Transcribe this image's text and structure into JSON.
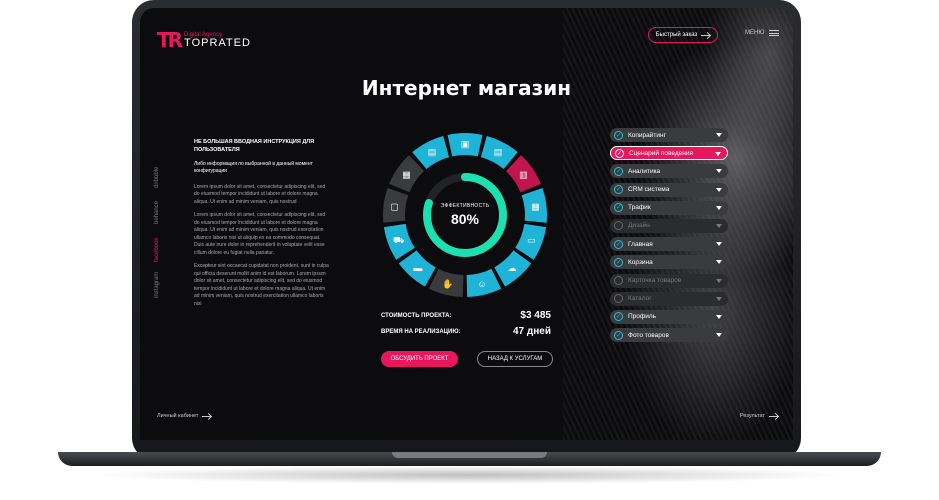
{
  "brand": {
    "mark": "TR",
    "sub": "Digital Agency",
    "name": "TOPRATED"
  },
  "header": {
    "quick_order": "Быстрый заказ",
    "menu": "МЕНЮ"
  },
  "title": "Интернет магазин",
  "social": [
    "dribbble",
    "behance",
    "facebook",
    "instagram"
  ],
  "intro": {
    "heading": "НЕ БОЛЬШАЯ ВВОДНАЯ ИНСТРУКЦИЯ ДЛЯ ПОЛЬЗОВАТЕЛЯ",
    "sub": "Либо информация по выбранной в данный момент конфигурации",
    "p1": "Lorem ipsum dolor sit amet, consectetur adipiscing elit, sed do eiusmod tempor incididunt ut labore et dolore magna aliqua. Ut enim ad minim veniam, quis nostrud",
    "p2": "Lorem ipsum dolor sit amet, consectetur adipiscing elit, sed do eiusmod tempor incididunt ut labore et dolore magna aliqua. Ut enim ad minim veniam, quis nostrud exercitation ullamco laboris nisi ut aliquip ex ea commodo consequat. Duis aute irure dolor in reprehenderit in voluptate velit esse cillum dolore eu fugiat nulla pariatur.",
    "p3": "Excepteur sint occaecat cupidatat non proident, sunt in culpa qui officia deserunt mollit anim id est laborum. Lorem ipsum dolor sit amet, consectetur adipiscing elit, sed do eiusmod tempor incididunt ut labore et dolore magna aliqua. Ut enim ad minim veniam, quis nostrud exercitation ullamco laboris nisi"
  },
  "efficiency": {
    "label": "ЭФФЕКТИВНОСТЬ",
    "value": "80%",
    "fraction": 0.8
  },
  "cost": {
    "label": "СТОИМОСТЬ ПРОЕКТА:",
    "value": "$3 485"
  },
  "time": {
    "label": "ВРЕМЯ НА РЕАЛИЗАЦИЮ:",
    "value": "47 дней"
  },
  "buttons": {
    "discuss": "ОБСУДИТЬ ПРОЕКТ",
    "back": "НАЗАД К УСЛУГАМ"
  },
  "services": [
    {
      "label": "Копирайтинг",
      "state": "on"
    },
    {
      "label": "Сценарий поведения",
      "state": "active"
    },
    {
      "label": "Аналитика",
      "state": "on"
    },
    {
      "label": "CRM система",
      "state": "on"
    },
    {
      "label": "Трафик",
      "state": "on"
    },
    {
      "label": "Дизайн",
      "state": "off"
    },
    {
      "label": "Главная",
      "state": "on"
    },
    {
      "label": "Корзина",
      "state": "on"
    },
    {
      "label": "Карточка товаров",
      "state": "off"
    },
    {
      "label": "Каталог",
      "state": "off"
    },
    {
      "label": "Профиль",
      "state": "on"
    },
    {
      "label": "Фото товаров",
      "state": "on"
    }
  ],
  "footer": {
    "cabinet": "Личный кабинет",
    "result": "Результат"
  },
  "colors": {
    "accent": "#e8175d",
    "cyan": "#1fb3d8",
    "teal": "#1de0b0",
    "gray": "#3a3b3f"
  },
  "segments": [
    {
      "color": "#1fb3d8",
      "icon": "image-icon"
    },
    {
      "color": "#1fb3d8",
      "icon": "document-icon"
    },
    {
      "color": "#c2154f",
      "icon": "clipboard-icon"
    },
    {
      "color": "#1fb3d8",
      "icon": "chart-icon"
    },
    {
      "color": "#1fb3d8",
      "icon": "tablet-icon"
    },
    {
      "color": "#1fb3d8",
      "icon": "cloud-icon"
    },
    {
      "color": "#1fb3d8",
      "icon": "users-icon"
    },
    {
      "color": "#3a3b3f",
      "icon": "hand-icon"
    },
    {
      "color": "#1fb3d8",
      "icon": "card-icon"
    },
    {
      "color": "#1fb3d8",
      "icon": "cart-icon"
    },
    {
      "color": "#3a3b3f",
      "icon": "monitor-icon"
    },
    {
      "color": "#3a3b3f",
      "icon": "grid-icon"
    },
    {
      "color": "#1fb3d8",
      "icon": "layout-icon"
    }
  ]
}
